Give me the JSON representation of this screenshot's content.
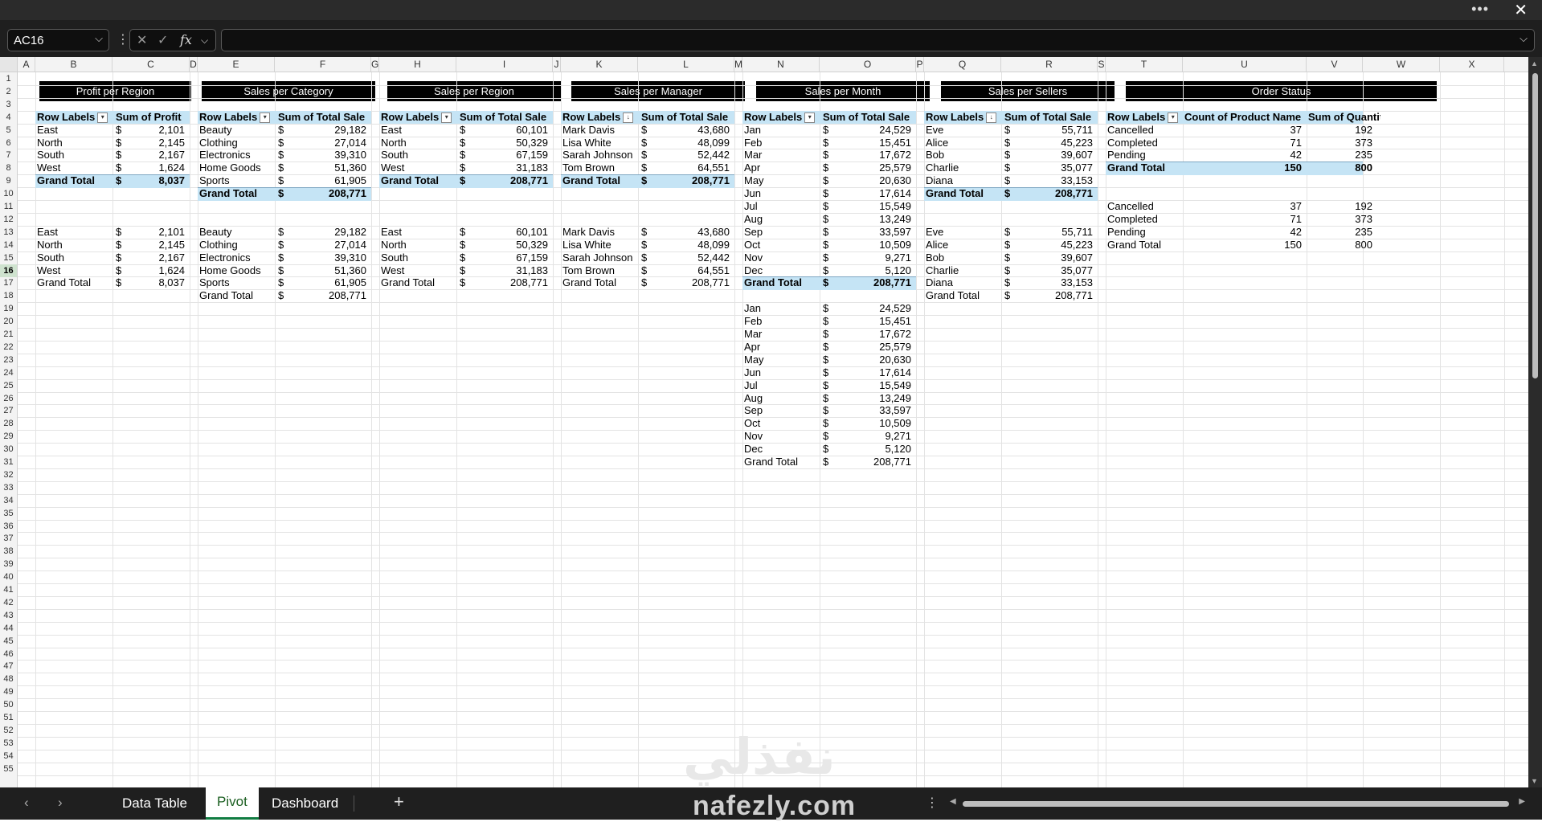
{
  "formula_bar": {
    "name_box": "AC16",
    "formula_value": ""
  },
  "columns": [
    "A",
    "B",
    "C",
    "D",
    "E",
    "F",
    "G",
    "H",
    "I",
    "J",
    "K",
    "L",
    "M",
    "N",
    "O",
    "P",
    "Q",
    "R",
    "S",
    "T",
    "U",
    "V",
    "W",
    "X"
  ],
  "row_count": 55,
  "selected_row": 16,
  "common": {
    "row_labels": "Row Labels",
    "grand_total": "Grand Total",
    "dollar": "$"
  },
  "tables": {
    "profit_region": {
      "title": "Profit per Region",
      "value_header": "Sum of Profit",
      "rows": [
        [
          "East",
          "2,101"
        ],
        [
          "North",
          "2,145"
        ],
        [
          "South",
          "2,167"
        ],
        [
          "West",
          "1,624"
        ]
      ],
      "total": "8,037"
    },
    "sales_category": {
      "title": "Sales per Category",
      "value_header": "Sum of Total Sale",
      "rows": [
        [
          "Beauty",
          "29,182"
        ],
        [
          "Clothing",
          "27,014"
        ],
        [
          "Electronics",
          "39,310"
        ],
        [
          "Home Goods",
          "51,360"
        ],
        [
          "Sports",
          "61,905"
        ]
      ],
      "total": "208,771"
    },
    "sales_region": {
      "title": "Sales per Region",
      "value_header": "Sum of Total Sale",
      "rows": [
        [
          "East",
          "60,101"
        ],
        [
          "North",
          "50,329"
        ],
        [
          "South",
          "67,159"
        ],
        [
          "West",
          "31,183"
        ]
      ],
      "total": "208,771"
    },
    "sales_manager": {
      "title": "Sales per Manager",
      "value_header": "Sum of Total Sale",
      "rows": [
        [
          "Mark Davis",
          "43,680"
        ],
        [
          "Lisa White",
          "48,099"
        ],
        [
          "Sarah Johnson",
          "52,442"
        ],
        [
          "Tom Brown",
          "64,551"
        ]
      ],
      "total": "208,771"
    },
    "sales_month": {
      "title": "Sales per Month",
      "value_header": "Sum of Total Sale",
      "rows": [
        [
          "Jan",
          "24,529"
        ],
        [
          "Feb",
          "15,451"
        ],
        [
          "Mar",
          "17,672"
        ],
        [
          "Apr",
          "25,579"
        ],
        [
          "May",
          "20,630"
        ],
        [
          "Jun",
          "17,614"
        ],
        [
          "Jul",
          "15,549"
        ],
        [
          "Aug",
          "13,249"
        ],
        [
          "Sep",
          "33,597"
        ],
        [
          "Oct",
          "10,509"
        ],
        [
          "Nov",
          "9,271"
        ],
        [
          "Dec",
          "5,120"
        ]
      ],
      "total": "208,771"
    },
    "sales_sellers": {
      "title": "Sales per Sellers",
      "value_header": "Sum of Total Sale",
      "rows": [
        [
          "Eve",
          "55,711"
        ],
        [
          "Alice",
          "45,223"
        ],
        [
          "Bob",
          "39,607"
        ],
        [
          "Charlie",
          "35,077"
        ],
        [
          "Diana",
          "33,153"
        ]
      ],
      "total": "208,771"
    },
    "order_status": {
      "title": "Order Status",
      "header_count": "Count of Product Name",
      "header_qty": "Sum of Quantity Sold",
      "rows": [
        [
          "Cancelled",
          "37",
          "192"
        ],
        [
          "Completed",
          "71",
          "373"
        ],
        [
          "Pending",
          "42",
          "235"
        ]
      ],
      "total_count": "150",
      "total_qty": "800"
    }
  },
  "sheet_tabs": [
    "Data Table",
    "Pivot",
    "Dashboard"
  ],
  "active_tab": "Pivot",
  "watermark": {
    "arabic": "نفذلي",
    "latin": "nafezly.com"
  }
}
